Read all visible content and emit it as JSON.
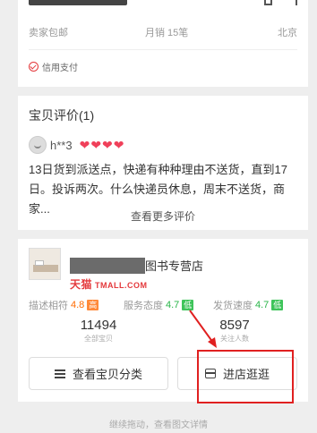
{
  "top": {
    "shipping": "卖家包邮",
    "monthly_sales": "月销 15笔",
    "location": "北京",
    "credit_pay": "信用支付"
  },
  "reviews": {
    "title": "宝贝评价(1)",
    "user": "h**3",
    "hearts": [
      "❤",
      "❤",
      "❤",
      "❤"
    ],
    "text": "13日货到派送点，快递有种种理由不送货，直到17日。投诉两次。什么快递员休息，周末不送货，商家...",
    "more": "查看更多评价"
  },
  "shop": {
    "name_suffix": "图书专营店",
    "brand": "天猫",
    "brand_domain": "TMALL.COM",
    "ratings": [
      {
        "label": "描述相符",
        "value": "4.8",
        "badge": "高",
        "tone": "orange"
      },
      {
        "label": "服务态度",
        "value": "4.7",
        "badge": "低",
        "tone": "green"
      },
      {
        "label": "发货速度",
        "value": "4.7",
        "badge": "低",
        "tone": "green"
      }
    ],
    "stats": [
      {
        "number": "11494",
        "label": "全部宝贝"
      },
      {
        "number": "8597",
        "label": "关注人数"
      }
    ],
    "btn_category": "查看宝贝分类",
    "btn_enter": "进店逛逛"
  },
  "footer": {
    "hint": "继续拖动，查看图文详情"
  },
  "colors": {
    "accent_red": "#e02020",
    "orange": "#ff6a00",
    "green": "#28b448"
  }
}
